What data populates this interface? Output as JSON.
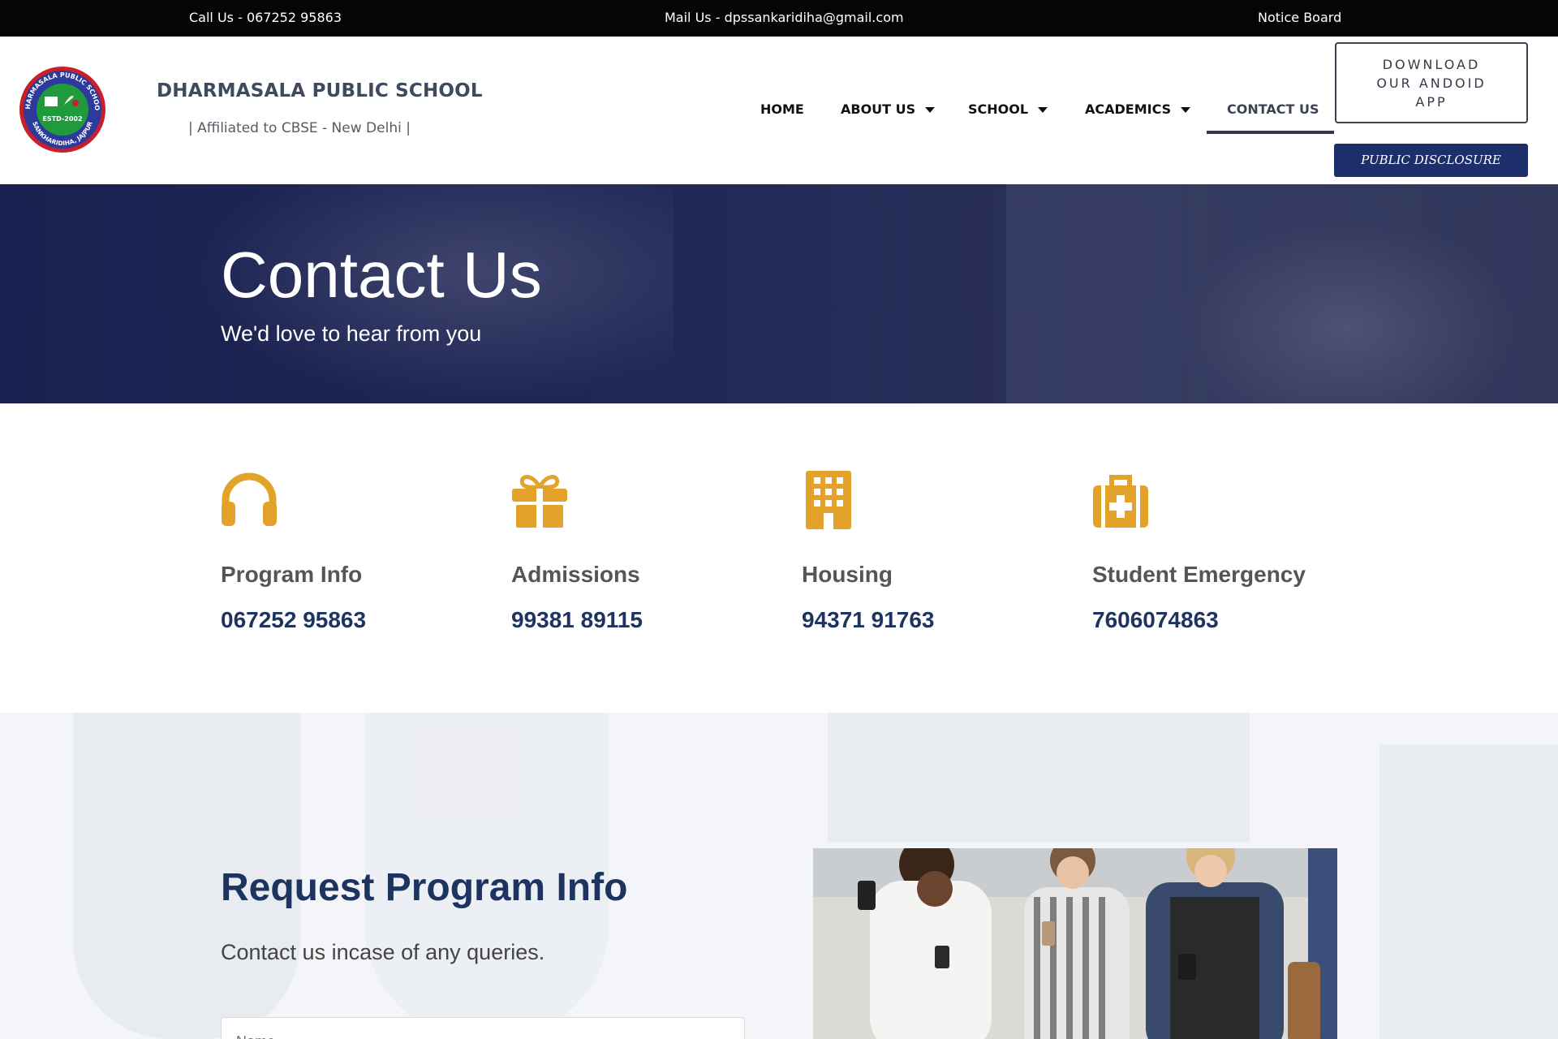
{
  "topbar": {
    "call": "Call Us - 067252 95863",
    "mail": "Mail Us - dpssankaridiha@gmail.com",
    "notice": "Notice Board"
  },
  "header": {
    "logo_text_top": "DHARMASALA PUBLIC SCHOOL",
    "logo_text_estd": "ESTD-2002",
    "logo_text_bottom": "SANKHARIDIHA, JAJPUR",
    "school_name": "DHARMASALA PUBLIC SCHOOL",
    "affiliation": "| Affiliated to CBSE - New Delhi |"
  },
  "nav": {
    "home": "HOME",
    "about": "ABOUT US",
    "school": "SCHOOL",
    "academics": "ACADEMICS",
    "contact": "CONTACT US"
  },
  "buttons": {
    "app_line1": "DOWNLOAD",
    "app_line2": "OUR ANDOID",
    "app_line3": "APP",
    "disclosure": "PUBLIC DISCLOSURE"
  },
  "hero": {
    "title": "Contact Us",
    "subtitle": "We'd love to hear from you"
  },
  "contacts": [
    {
      "icon": "headphones-icon",
      "label": "Program Info",
      "number": "067252 95863"
    },
    {
      "icon": "gift-icon",
      "label": "Admissions",
      "number": "99381 89115"
    },
    {
      "icon": "building-icon",
      "label": "Housing",
      "number": "94371 91763"
    },
    {
      "icon": "medkit-icon",
      "label": "Student Emergency",
      "number": "7606074863"
    }
  ],
  "colors": {
    "accent_gold": "#e3a32a",
    "navy": "#1d3461",
    "hero_bg": "#1f2754",
    "disclosure_bg": "#1c2f6a"
  },
  "request": {
    "title": "Request Program Info",
    "subtitle": "Contact us incase of any queries.",
    "name_placeholder": "Name"
  }
}
